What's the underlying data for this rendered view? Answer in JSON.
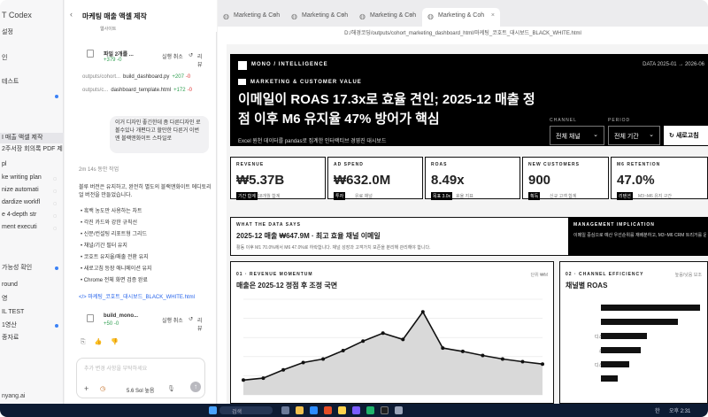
{
  "sidebar": {
    "app_title": "T Codex",
    "items": [
      {
        "label": "설정",
        "top": 31,
        "active": false,
        "dot": false
      },
      {
        "label": "인",
        "top": 60,
        "active": false,
        "dot": false
      },
      {
        "label": "테스트",
        "top": 87,
        "active": false,
        "dot": false
      },
      {
        "label": "",
        "top": 103,
        "active": false,
        "dot": true
      },
      {
        "label": "I 매출 액셀 제작",
        "top": 150,
        "active": true,
        "dot": false
      },
      {
        "label": "2주서장 회의록 PDF 제",
        "top": 163,
        "active": false,
        "dot": false
      },
      {
        "label": "pl",
        "top": 180,
        "active": false,
        "dot": false
      },
      {
        "label": "ke writing plan",
        "top": 195,
        "active": false,
        "dot": false
      },
      {
        "label": "nize automati",
        "top": 209,
        "active": false,
        "dot": false
      },
      {
        "label": "dardize workfl",
        "top": 223,
        "active": false,
        "dot": false
      },
      {
        "label": "e 4-depth str",
        "top": 237,
        "active": false,
        "dot": false
      },
      {
        "label": "ment executi",
        "top": 251,
        "active": false,
        "dot": false
      },
      {
        "label": "가능성 확인",
        "top": 297,
        "active": false,
        "dot": true
      },
      {
        "label": "round",
        "top": 316,
        "active": false,
        "dot": false
      },
      {
        "label": "영",
        "top": 332,
        "active": false,
        "dot": false
      },
      {
        "label": "IL TEST",
        "top": 347,
        "active": false,
        "dot": false
      },
      {
        "label": "1영산",
        "top": 362,
        "active": false,
        "dot": true
      },
      {
        "label": "종자료",
        "top": 376,
        "active": false,
        "dot": false
      }
    ],
    "footer": "nyang.ai"
  },
  "chat": {
    "title": "마케팅 매출 액셀 제작",
    "top_snippet": "웹사이트",
    "file_card": {
      "name": "파일 2개를 ...",
      "diff": "+379 -0",
      "undo": "실행 취소",
      "review": "리뷰"
    },
    "file_rows": [
      {
        "path": "outputs/cohort...",
        "file": "build_dashboard.py",
        "add": "+207",
        "del": "-0"
      },
      {
        "path": "outputs/c...",
        "file": "dashboard_template.html",
        "add": "+172",
        "del": "-0"
      }
    ],
    "user_bubble": "이거 디자인 좋긴한데 좀 다른디자인 로 볼수있나 개편다고 할만한 다른거 이번엔 블랙앤화이트 스타일로",
    "work_time": "2m 14s 동안 작업",
    "reply_intro": "블루 버전은 유지하고, 완전히 별도의 블랙앤화이트 에디토리얼 버전을 만들었습니다.",
    "bullets": [
      "흑백 농도만 사용하는 차트",
      "각진 카드와 강한 규칙선",
      "신문/컨설팅 리포트형 그리드",
      "채널/기간 필터 유지",
      "코호트 유지율/매출 전환 유지",
      "새로고침 등장 애니메이션 유지",
      "Chrome 전체 화면 검증 완료"
    ],
    "output_link": "마케팅_코호트_대시보드_BLACK_WHITE.html",
    "file_card2": {
      "name": "build_mono...",
      "diff": "+50 -0",
      "undo": "실행 취소",
      "review": "리뷰"
    },
    "composer_placeholder": "추가 변경 사항을 부탁하세요",
    "model": "5.6 Sol 높음"
  },
  "tabs": [
    {
      "label": "Marketing & Coh",
      "active": false
    },
    {
      "label": "Marketing & Coh",
      "active": false
    },
    {
      "label": "Marketing & Coh",
      "active": false
    },
    {
      "label": "Marketing & Coh",
      "active": true
    }
  ],
  "address": "D:/해경코딩/outputs/cohort_marketing_dashboard_html/마케팅_코호트_대시보드_BLACK_WHITE.html",
  "dashboard": {
    "brand": "MONO / INTELLIGENCE",
    "date_range": "DATA 2025-01 → 2026-06",
    "tag": "MARKETING & CUSTOMER VALUE",
    "headline": "이메일이 ROAS 17.3x로 효율 견인; 2025-12 매출 정점 이후 M6 유지율 47% 방어가 핵심",
    "hero_sub": "Excel 원천 데이터를 pandas로 집계한 인터랙티브 경영진 대시보드",
    "channel_label": "CHANNEL",
    "channel_value": "전체 채널",
    "period_label": "PERIOD",
    "period_value": "전체 기간",
    "refresh": "새로고침",
    "kpis": [
      {
        "label": "REVENUE",
        "value": "₩5.37B",
        "badge": "기간 합계",
        "note": "18개월 합계"
      },
      {
        "label": "AD SPEND",
        "value": "₩632.0M",
        "badge": "투자",
        "note": "유료 채널"
      },
      {
        "label": "ROAS",
        "value": "8.49x",
        "badge": "목표 3.0x",
        "note": "효율 지표"
      },
      {
        "label": "NEW CUSTOMERS",
        "value": "900",
        "badge": "획득",
        "note": "신규 고객 합계"
      },
      {
        "label": "M6 RETENTION",
        "value": "47.0%",
        "badge": "리텐션",
        "note": "M3~M6 유지 구간"
      }
    ],
    "wd_label": "WHAT THE DATA SAYS",
    "wd_title": "2025-12 매출 ₩647.9M · 최고 효율 채널 이메일",
    "wd_body": "활동 이후 M1 70.0%에서 M6 47.0%로 하락합니다. 채널 성장과 고객가치 보존을 분리해 관리해야 합니다.",
    "mi_label": "MANAGEMENT IMPLICATION",
    "mi_body": "이메일 중심으로 예산 우선순위를 재배분하고, M3~M6 CRM 트리거를 운영합니다.",
    "revenue": {
      "label": "01 · REVENUE MOMENTUM",
      "title": "매출은 2025-12 정점 후 조정 국면",
      "note": "단위 ₩M"
    },
    "channel": {
      "label": "02 · CHANNEL EFFICIENCY",
      "title": "채널별 ROAS",
      "note": "높음/낮음 보조"
    }
  },
  "chart_data": [
    {
      "type": "area",
      "title": "매출은 2025-12 정점 후 조정 국면",
      "values": [
        62,
        70,
        105,
        135,
        150,
        185,
        225,
        258,
        232,
        347,
        196,
        182,
        165,
        150,
        139,
        129
      ],
      "ylim": [
        0,
        400
      ]
    },
    {
      "type": "bar",
      "title": "채널별 ROAS",
      "categories": [
        "이메일",
        "검색",
        "디스플레이",
        "소셜광고",
        "디스플레이",
        "쇼핑"
      ],
      "values": [
        17.3,
        13.5,
        8.0,
        7.0,
        5.0,
        3.0
      ]
    }
  ],
  "taskbar": {
    "search": "검색",
    "time": "오후 2:31",
    "lang": "한"
  }
}
